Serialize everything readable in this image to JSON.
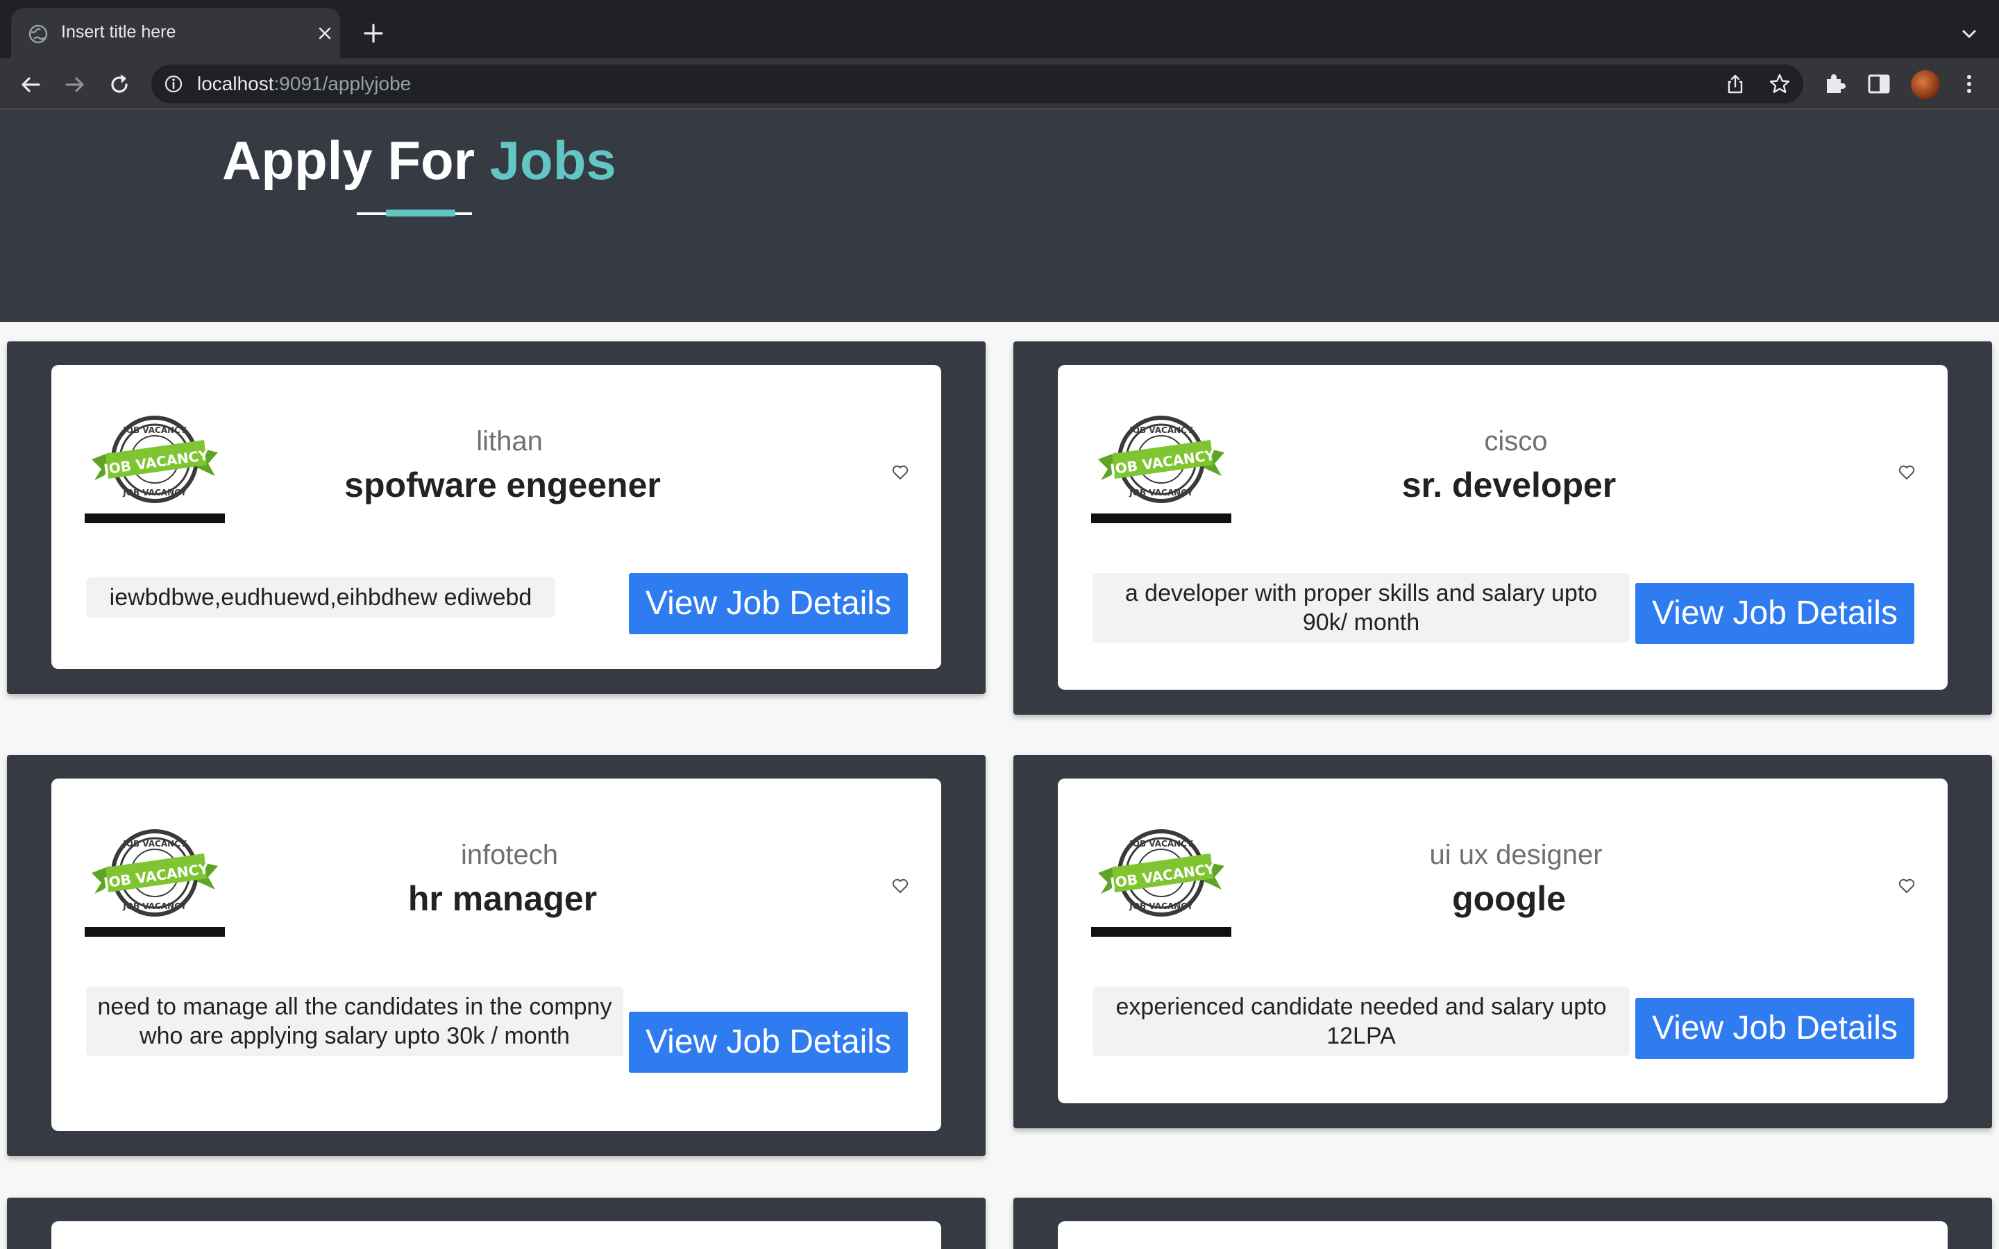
{
  "browser": {
    "tab_title": "Insert title here",
    "url_host": "localhost",
    "url_rest": ":9091/applyjobe"
  },
  "header": {
    "title_white": "Apply For",
    "title_accent": "Jobs"
  },
  "colors": {
    "header_bg": "#353a43",
    "accent": "#62c6c4",
    "button_blue": "#2f7bf0",
    "logo_green": "#7fc531"
  },
  "jobs": [
    {
      "company": "lithan",
      "role": "spofware engeener",
      "description": "iewbdbwe,eudhuewd,eihbdhew ediwebd",
      "button_label": "View Job Details",
      "logo_label": "JOB VACANCY"
    },
    {
      "company": "cisco",
      "role": "sr. developer",
      "description": "a developer with proper skills and salary upto 90k/ month",
      "button_label": "View Job Details",
      "logo_label": "JOB VACANCY"
    },
    {
      "company": "infotech",
      "role": "hr manager",
      "description": "need to manage all the candidates in the compny who are applying salary upto 30k / month",
      "button_label": "View Job Details",
      "logo_label": "JOB VACANCY"
    },
    {
      "company": "ui ux designer",
      "role": "google",
      "description": "experienced candidate needed and salary upto 12LPA",
      "button_label": "View Job Details",
      "logo_label": "JOB VACANCY"
    }
  ]
}
